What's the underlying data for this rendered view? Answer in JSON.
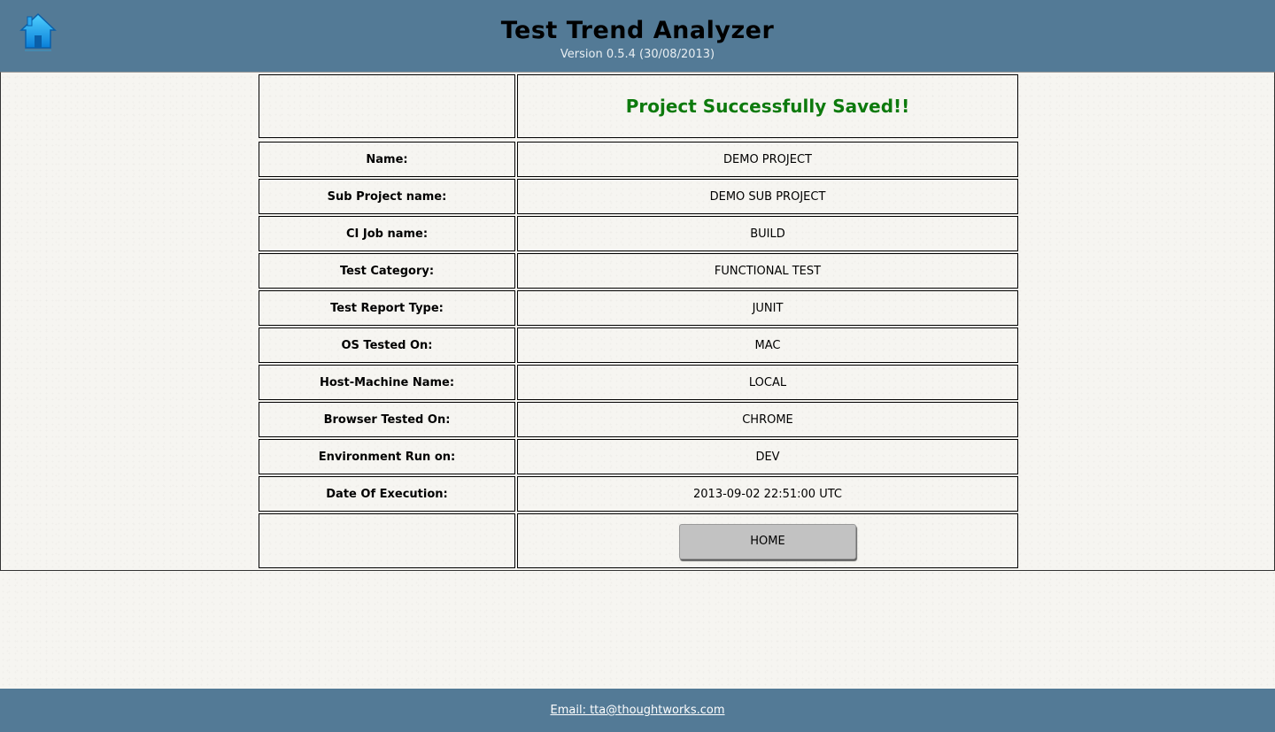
{
  "header": {
    "title": "Test Trend Analyzer",
    "version": "Version 0.5.4 (30/08/2013)",
    "home_icon": "home-icon"
  },
  "status": {
    "message": "Project Successfully Saved!!",
    "color": "#0d7a0d"
  },
  "details": [
    {
      "label": "Name:",
      "value": "DEMO PROJECT"
    },
    {
      "label": "Sub Project name:",
      "value": "DEMO SUB PROJECT"
    },
    {
      "label": "CI Job name:",
      "value": "BUILD"
    },
    {
      "label": "Test Category:",
      "value": "FUNCTIONAL TEST"
    },
    {
      "label": "Test Report Type:",
      "value": "JUNIT"
    },
    {
      "label": "OS Tested On:",
      "value": "MAC"
    },
    {
      "label": "Host-Machine Name:",
      "value": "LOCAL"
    },
    {
      "label": "Browser Tested On:",
      "value": "CHROME"
    },
    {
      "label": "Environment Run on:",
      "value": "DEV"
    },
    {
      "label": "Date Of Execution:",
      "value": "2013-09-02 22:51:00 UTC"
    }
  ],
  "actions": {
    "home_button_label": "HOME"
  },
  "footer": {
    "email_text": "Email: tta@thoughtworks.com"
  },
  "colors": {
    "header_bg": "#537a96",
    "footer_bg": "#537a96",
    "button_bg": "#c2c2c2"
  }
}
